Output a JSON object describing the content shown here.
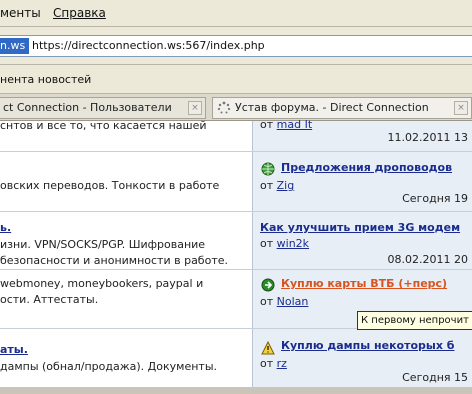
{
  "menu": {
    "item1": "менты",
    "item2": "Справка"
  },
  "address": {
    "selected": "n.ws",
    "url": "https://directconnection.ws:567/index.php"
  },
  "bookmarks": {
    "label": "нента новостей"
  },
  "tabs": [
    {
      "label": "ct Connection - Пользователи",
      "close": "×"
    },
    {
      "label": "Устав форума. - Direct Connection",
      "close": "×"
    }
  ],
  "rows": [
    {
      "left": {
        "title": "",
        "lines": [
          "снтов и все то, что касается нашей"
        ]
      },
      "right": {
        "title": "",
        "from_prefix": "от",
        "user": "mad It",
        "date": "11.02.2011 13"
      }
    },
    {
      "left": {
        "title": "",
        "lines": [
          "овских переводов. Тонкости в работе"
        ]
      },
      "right": {
        "title": "Предложения дроповодов",
        "from_prefix": "от",
        "user": "Zig",
        "date": "Сегодня 19"
      }
    },
    {
      "left": {
        "title": "ь.",
        "lines": [
          "изни. VPN/SOCKS/PGP. Шифрование",
          "безопасности и анонимности в работе."
        ]
      },
      "right": {
        "title": "Как улучшить прием 3G модем",
        "from_prefix": "от",
        "user": "win2k",
        "date": "08.02.2011 20"
      }
    },
    {
      "left": {
        "title": "",
        "lines": [
          "webmoney, moneybookers, paypal и",
          "ости. Аттестаты."
        ]
      },
      "right": {
        "title": "Куплю карты ВТБ (+перс)",
        "from_prefix": "от",
        "user": "Nolan",
        "date": ""
      }
    },
    {
      "left": {
        "title": "аты.",
        "lines": [
          "дампы (обнал/продажа). Документы."
        ]
      },
      "right": {
        "title": "Куплю дампы некоторых б",
        "from_prefix": "от",
        "user": "rz",
        "date": "Сегодня 15"
      }
    }
  ],
  "tooltip": "К первому непрочит",
  "colors": {
    "link": "#1a2d8f",
    "link_red": "#d9531e",
    "right_bg": "#e8eef5",
    "tooltip_bg": "#ffffe1"
  }
}
